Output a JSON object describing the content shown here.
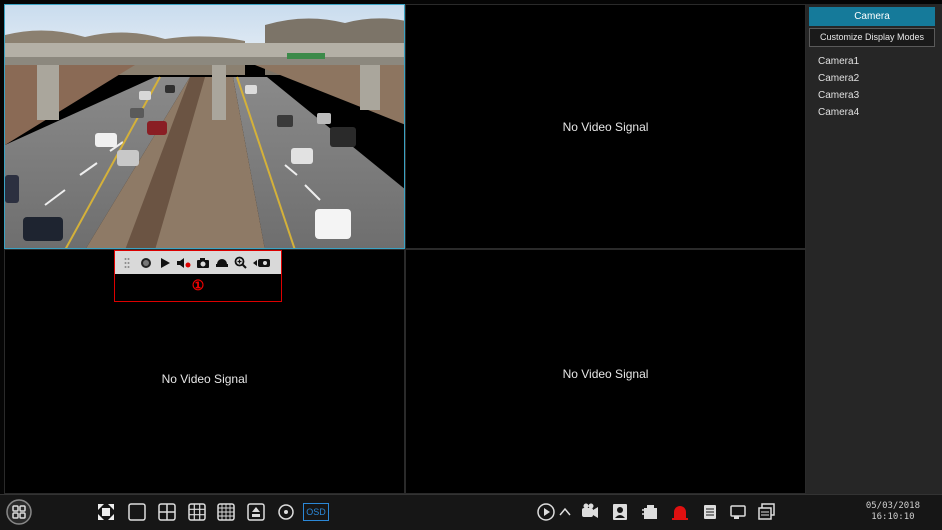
{
  "grid": {
    "cells": [
      {
        "label": ""
      },
      {
        "label": "No Video Signal"
      },
      {
        "label": "No Video Signal"
      },
      {
        "label": "No Video Signal"
      }
    ]
  },
  "preview_toolbar": {
    "number": "①",
    "icons": [
      "grip-icon",
      "record-icon",
      "play-icon",
      "mute-icon",
      "snapshot-icon",
      "ptz-icon",
      "zoom-icon",
      "camera-switch-icon"
    ]
  },
  "panel": {
    "header": "Camera",
    "mode_button": "Customize Display Modes",
    "cameras": [
      "Camera1",
      "Camera2",
      "Camera3",
      "Camera4"
    ]
  },
  "bottom": {
    "osd_label": "OSD",
    "date": "05/03/2018",
    "time": "16:10:10",
    "accent": "#2b88d8",
    "alarm_color": "#e01010"
  }
}
